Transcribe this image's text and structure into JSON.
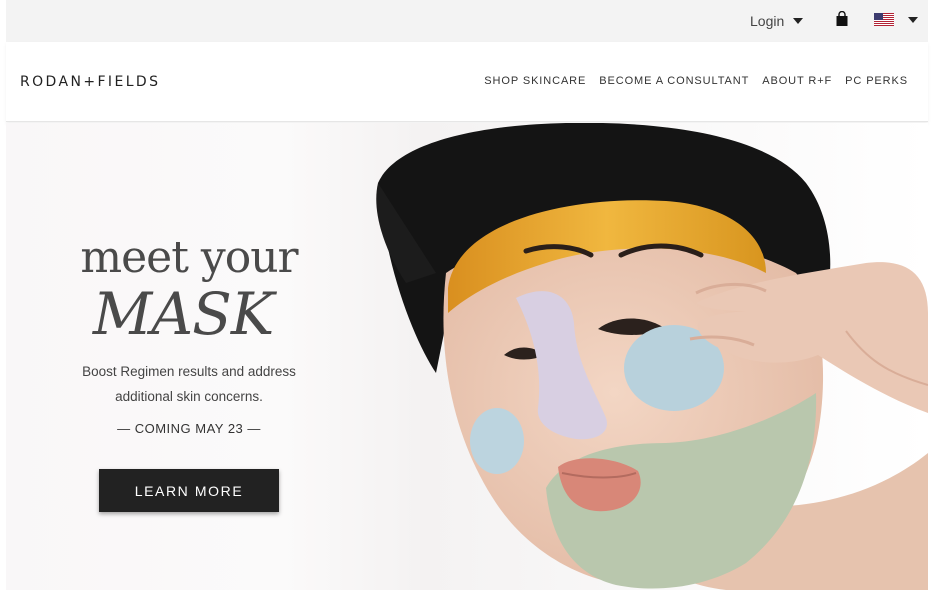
{
  "utility": {
    "login_label": "Login",
    "icons": [
      "chevron-down-icon",
      "shopping-bag-icon",
      "us-flag-icon"
    ]
  },
  "header": {
    "logo": "RODAN+FIELDS",
    "nav": [
      {
        "label": "SHOP SKINCARE"
      },
      {
        "label": "BECOME A CONSULTANT"
      },
      {
        "label": "ABOUT R+F"
      },
      {
        "label": "PC PERKS"
      }
    ]
  },
  "hero": {
    "headline_line1": "meet your",
    "headline_line2": "MASK",
    "subcopy_line1": "Boost Regimen results and address",
    "subcopy_line2": "additional skin concerns.",
    "coming": "— COMING MAY 23 —",
    "cta_label": "LEARN MORE"
  },
  "colors": {
    "cta_background": "#222222",
    "utility_background": "#f3f3f3",
    "mask_gold": "#e2a12c",
    "mask_lavender": "#d6ccde",
    "mask_blue": "#b9d3de",
    "mask_green": "#b9c7ad"
  }
}
